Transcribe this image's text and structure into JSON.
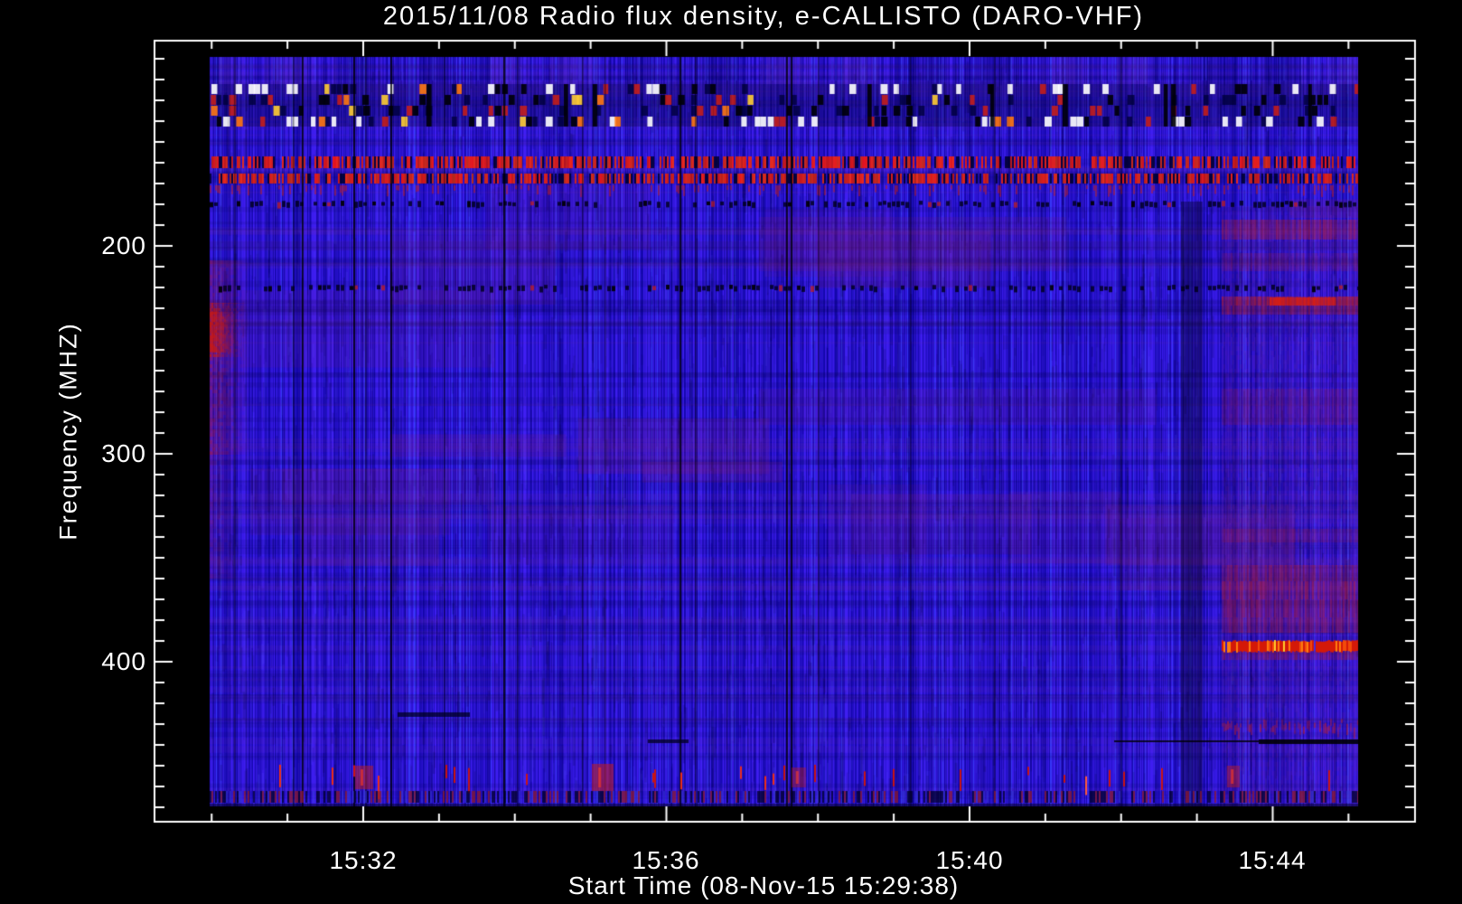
{
  "title": "2015/11/08  Radio flux density, e-CALLISTO (DARO-VHF)",
  "x_axis": {
    "label": "Start Time (08-Nov-15 15:29:38)",
    "major_tick_labels": [
      "15:32",
      "15:36",
      "15:40",
      "15:44"
    ]
  },
  "y_axis": {
    "label": "Frequency (MHZ)",
    "major_tick_labels": [
      "200",
      "300",
      "400"
    ]
  },
  "chart_data": {
    "type": "heatmap",
    "title": "2015/11/08  Radio flux density, e-CALLISTO (DARO-VHF)",
    "xlabel": "Start Time (08-Nov-15 15:29:38)",
    "ylabel": "Frequency (MHZ)",
    "instrument": "e-CALLISTO (DARO-VHF)",
    "date": "2015/11/08",
    "start_time": "15:29:38",
    "x_tick_times_major": [
      "15:32",
      "15:36",
      "15:40",
      "15:44"
    ],
    "x_tick_times_minor": [
      "15:30",
      "15:31",
      "15:33",
      "15:34",
      "15:35",
      "15:37",
      "15:38",
      "15:39",
      "15:41",
      "15:42",
      "15:43",
      "15:45"
    ],
    "x_range_time": [
      "15:29:38",
      "15:45:55"
    ],
    "y_ticks_mhz": [
      200,
      300,
      400
    ],
    "y_range_mhz_displayed": [
      101,
      477
    ],
    "y_axis_direction": "frequency increases downward",
    "data_coverage_time": [
      "15:30:00",
      "15:45:10"
    ],
    "data_coverage_mhz": [
      109,
      470
    ],
    "grid": false,
    "legend": false,
    "colormap": {
      "background_low": "#2318dc",
      "mid": "#5a2aa0",
      "high": "#cc2211",
      "very_high": "#ff7711",
      "peak": "#ffcc33",
      "dropout": "#000000",
      "axis": "#ffffff",
      "page_background": "#000000"
    },
    "features": [
      {
        "kind": "quiet background",
        "freq_mhz": [
          109,
          470
        ],
        "note": "uniform blue background with fine vertical striation over the whole record"
      },
      {
        "kind": "interference band with bursts",
        "freq_mhz": [
          122,
          143
        ],
        "time": [
          "15:30",
          "15:45"
        ],
        "note": "row of red/orange/yellow blobs mixed with black dropout bars near top of band"
      },
      {
        "kind": "narrow RFI line",
        "freq_mhz": [
          157,
          163
        ],
        "time": [
          "15:30",
          "15:45"
        ],
        "note": "bright red dashed horizontal line across full record"
      },
      {
        "kind": "narrow RFI line",
        "freq_mhz": [
          165,
          170
        ],
        "time": [
          "15:30",
          "15:45"
        ],
        "note": "second bright red dashed horizontal line across full record"
      },
      {
        "kind": "dark absorption lane",
        "freq_mhz": 180,
        "time": [
          "15:30",
          "15:45"
        ],
        "note": "dark dashed horizontal lane"
      },
      {
        "kind": "dark absorption lane",
        "freq_mhz": 221,
        "time": [
          "15:30",
          "15:45"
        ],
        "note": "dark dashed horizontal lane"
      },
      {
        "kind": "strong emission patch",
        "freq_mhz": [
          227,
          300
        ],
        "time": [
          "15:30:00",
          "15:30:30"
        ],
        "note": "bright red blob at the very start of the record, strongest 228-256 MHz"
      },
      {
        "kind": "disturbed section",
        "freq_mhz": [
          155,
          470
        ],
        "time": [
          "15:43:20",
          "15:45:10"
        ],
        "note": "reddish/purple section with several red horizontal bands"
      },
      {
        "kind": "strong RFI line",
        "freq_mhz": [
          390,
          395
        ],
        "time": [
          "15:43:20",
          "15:45:10"
        ],
        "note": "very bright red-orange horizontal line in right-hand section"
      },
      {
        "kind": "red band group",
        "freq_mhz": [
          353,
          386
        ],
        "time": [
          "15:43:20",
          "15:45:10"
        ],
        "note": "stack of dark-red rows"
      },
      {
        "kind": "black dropout line",
        "freq_mhz": 437,
        "time": [
          "15:42:15",
          "15:45:10"
        ],
        "note": "horizontal black data-gap line near bottom right"
      },
      {
        "kind": "impulsive spikes",
        "freq_mhz": [
          449,
          462
        ],
        "time": [
          "15:30",
          "15:45"
        ],
        "note": "row of short vertical bright red ticks along bottom of record"
      },
      {
        "kind": "speckled band",
        "freq_mhz": [
          462,
          468
        ],
        "time": [
          "15:30",
          "15:45"
        ],
        "note": "dense blue/dark/red speckled bottom edge band"
      },
      {
        "kind": "vertical dropout lines",
        "freq_mhz": [
          109,
          470
        ],
        "note": "numerous thin black vertical calibration/data-gap lines, e.g. near 15:31:12, 15:31:54, 15:32:24, 15:33:53, 15:36:12, 15:37:37, 15:42:50"
      }
    ]
  }
}
